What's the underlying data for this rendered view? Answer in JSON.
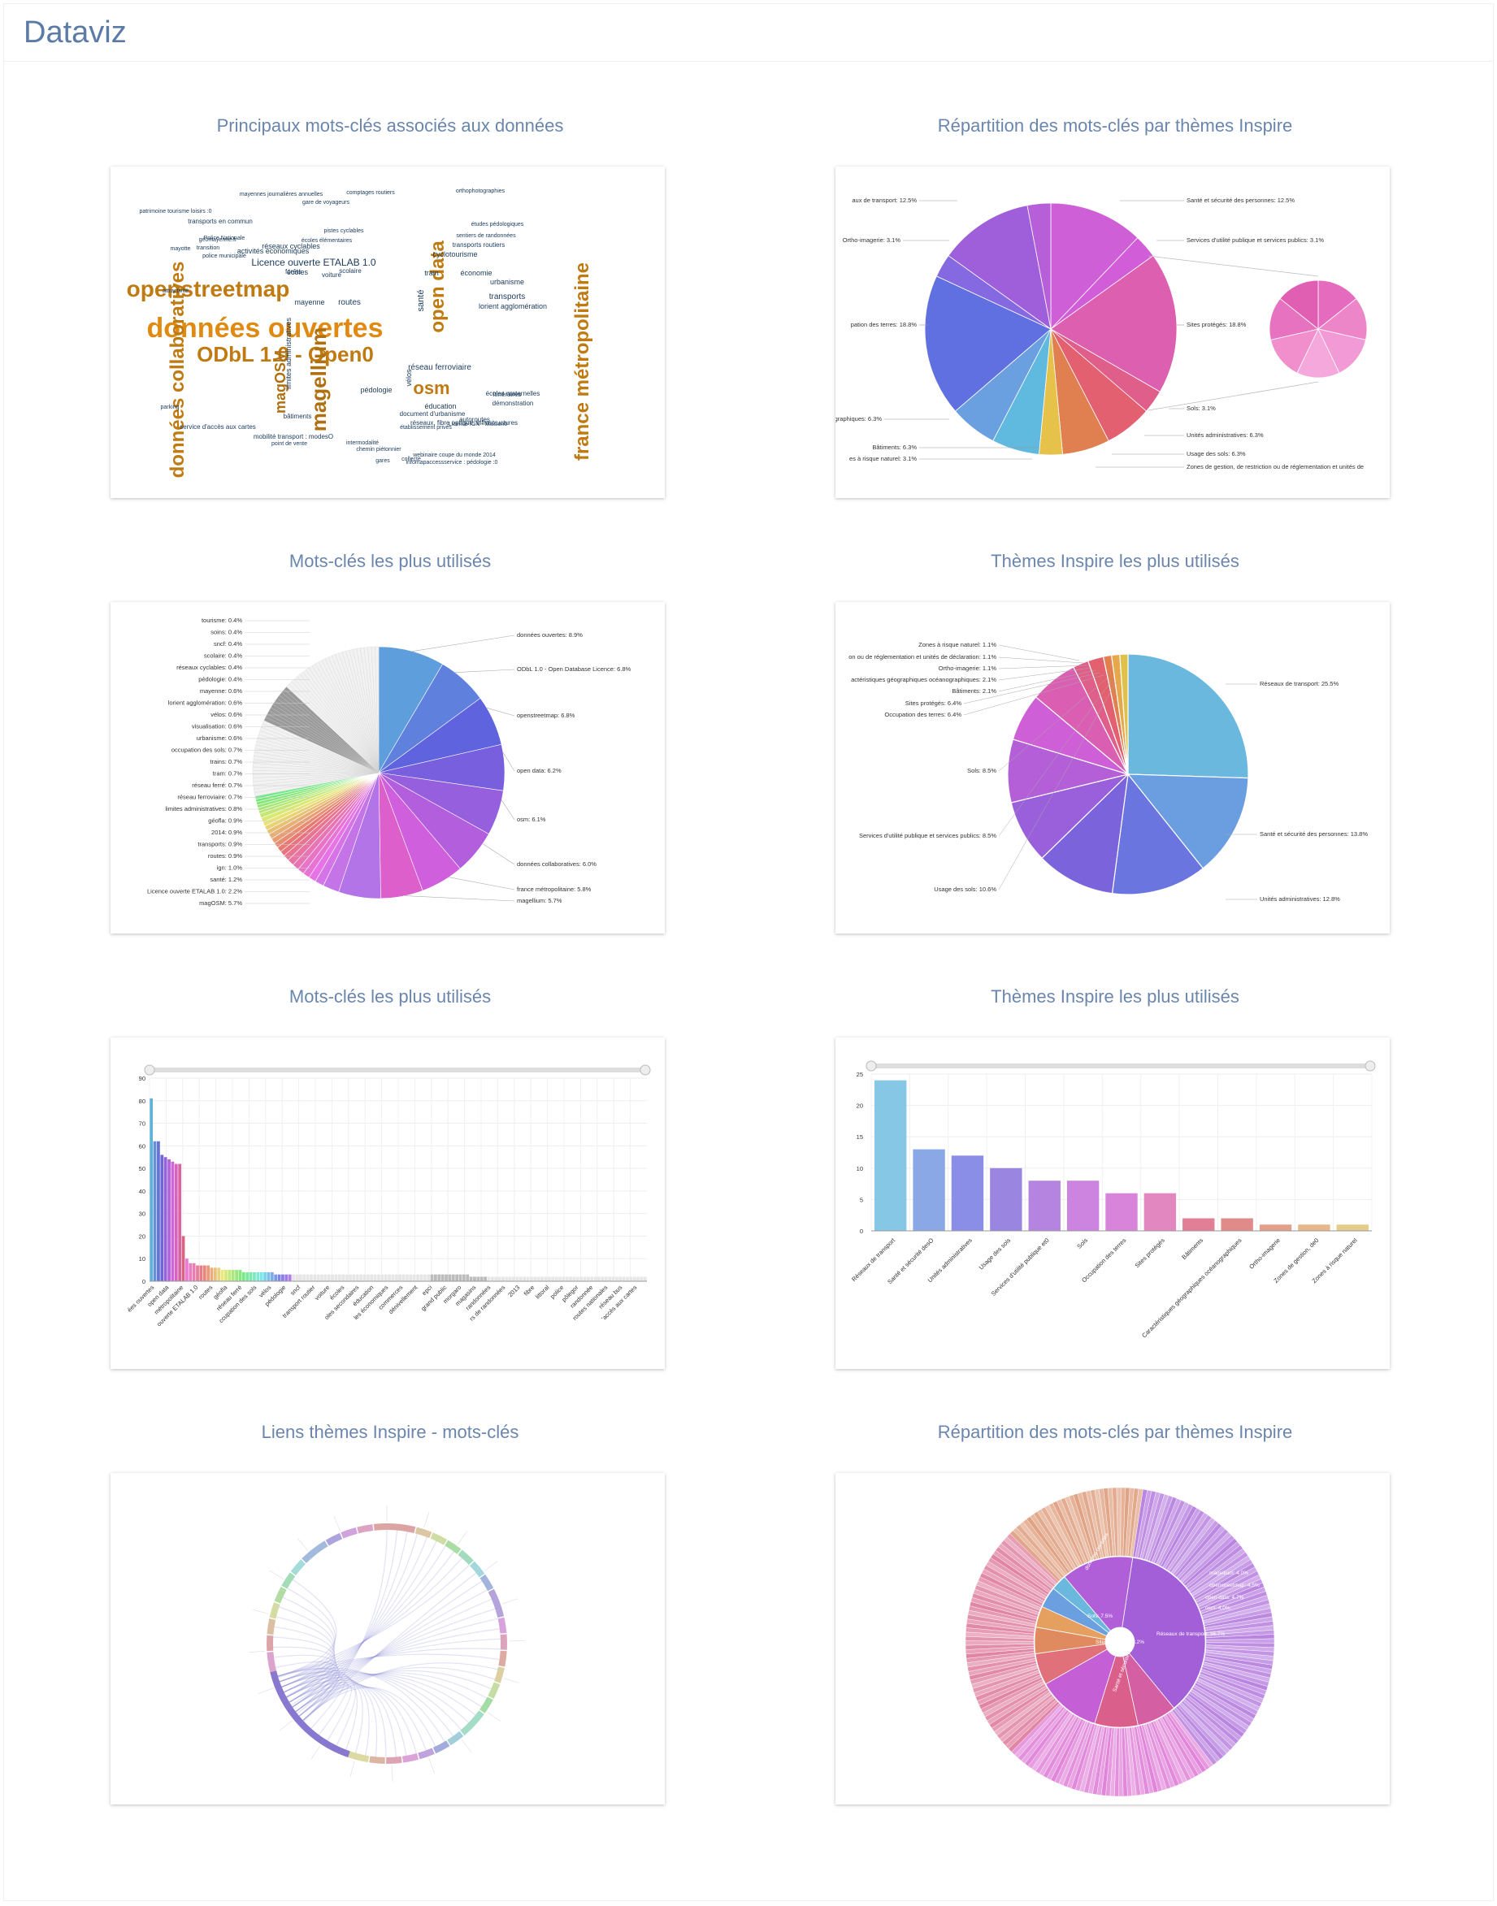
{
  "app": {
    "title": "Dataviz"
  },
  "panels": [
    {
      "title": "Principaux mots-clés associés aux données"
    },
    {
      "title": "Répartition des mots-clés par thèmes Inspire"
    },
    {
      "title": "Mots-clés les plus utilisés"
    },
    {
      "title": "Thèmes Inspire les plus utilisés"
    },
    {
      "title": "Mots-clés les plus utilisés"
    },
    {
      "title": "Thèmes Inspire les plus utilisés"
    },
    {
      "title": "Liens thèmes Inspire - mots-clés"
    },
    {
      "title": "Répartition des mots-clés par thèmes Inspire"
    }
  ],
  "wordcloud": {
    "words": [
      {
        "text": "données ouvertes",
        "color": "#e08a12"
      },
      {
        "text": "openstreetmap",
        "color": "#c07a12"
      },
      {
        "text": "ODbL 1.0 - Open0",
        "color": "#c07a12"
      },
      {
        "text": "données collaboratives",
        "color": "#c07a12"
      },
      {
        "text": "magellium",
        "color": "#b07012"
      },
      {
        "text": "france métropolitaine",
        "color": "#c07a12"
      },
      {
        "text": "open data",
        "color": "#c07a12"
      },
      {
        "text": "magOSM",
        "color": "#b07012"
      },
      {
        "text": "osm",
        "color": "#c07a12"
      },
      {
        "text": "Licence ouverte ETALAB 1.0",
        "color": "#1a3a5c"
      },
      {
        "text": "routes",
        "color": "#1a3a5c"
      },
      {
        "text": "santé",
        "color": "#1a3a5c"
      },
      {
        "text": "mayenne",
        "color": "#1a3a5c"
      },
      {
        "text": "transports",
        "color": "#1a3a5c"
      },
      {
        "text": "réseau ferroviaire",
        "color": "#1a3a5c"
      },
      {
        "text": "éducation",
        "color": "#1a3a5c"
      },
      {
        "text": "urbanisme",
        "color": "#1a3a5c"
      },
      {
        "text": "pédologie",
        "color": "#1a3a5c"
      },
      {
        "text": "vélos",
        "color": "#1a3a5c"
      },
      {
        "text": "écoles",
        "color": "#1a3a5c"
      },
      {
        "text": "scolaire",
        "color": "#1a3a5c"
      },
      {
        "text": "cyclotourisme",
        "color": "#1a3a5c"
      },
      {
        "text": "réseaux cyclables",
        "color": "#1a3a5c"
      },
      {
        "text": "activités économiques",
        "color": "#1a3a5c"
      },
      {
        "text": "transports en commun",
        "color": "#1a3a5c"
      },
      {
        "text": "lorient agglomération",
        "color": "#1a3a5c"
      },
      {
        "text": "démonstration",
        "color": "#1a3a5c"
      },
      {
        "text": "bâtiments",
        "color": "#1a3a5c"
      },
      {
        "text": "écoles maternelles",
        "color": "#1a3a5c"
      },
      {
        "text": "itinéraires",
        "color": "#1a3a5c"
      },
      {
        "text": "autoroutes",
        "color": "#1a3a5c"
      },
      {
        "text": "service d'accès aux cartes",
        "color": "#1a3a5c"
      },
      {
        "text": "mobilité transport : modesO",
        "color": "#1a3a5c"
      },
      {
        "text": "point de vente",
        "color": "#1a3a5c"
      },
      {
        "text": "intermodalité",
        "color": "#1a3a5c"
      },
      {
        "text": "document d'urbanisme",
        "color": "#1a3a5c"
      },
      {
        "text": "infomapaccessservice : pédologie :0",
        "color": "#1a3a5c"
      },
      {
        "text": "mayennes journalières annuelles",
        "color": "#1a3a5c"
      },
      {
        "text": "comptages routiers",
        "color": "#1a3a5c"
      },
      {
        "text": "orthophotographies",
        "color": "#1a3a5c"
      },
      {
        "text": "patrimoine tourisme loisirs :0",
        "color": "#1a3a5c"
      },
      {
        "text": "écoles élémentaires",
        "color": "#1a3a5c"
      },
      {
        "text": "pistes cyclables",
        "color": "#1a3a5c"
      },
      {
        "text": "transports routiers",
        "color": "#1a3a5c"
      },
      {
        "text": "gare de voyageurs",
        "color": "#1a3a5c"
      },
      {
        "text": "sentiers de randonnées",
        "color": "#1a3a5c"
      },
      {
        "text": "études pédologiques",
        "color": "#1a3a5c"
      },
      {
        "text": "établissement privés",
        "color": "#1a3a5c"
      },
      {
        "text": "Licence IGN - Mission0",
        "color": "#1a3a5c"
      },
      {
        "text": "chemin piétonnier",
        "color": "#1a3a5c"
      },
      {
        "text": "webinaire coupe du monde 2014",
        "color": "#1a3a5c"
      },
      {
        "text": "réseaux, fibre optique, infrastructures",
        "color": "#1a3a5c"
      },
      {
        "text": "limites administratives",
        "color": "#1a3a5c"
      },
      {
        "text": "Police Nationale",
        "color": "#1a3a5c"
      },
      {
        "text": "police municipale",
        "color": "#1a3a5c"
      },
      {
        "text": "transition",
        "color": "#1a3a5c"
      },
      {
        "text": "géomayenne.fr",
        "color": "#1a3a5c"
      },
      {
        "text": "voiture",
        "color": "#1a3a5c"
      },
      {
        "text": "forêts",
        "color": "#1a3a5c"
      },
      {
        "text": "train",
        "color": "#1a3a5c"
      },
      {
        "text": "économie",
        "color": "#1a3a5c"
      },
      {
        "text": "gares",
        "color": "#1a3a5c"
      },
      {
        "text": "collecte",
        "color": "#1a3a5c"
      },
      {
        "text": "attractivité",
        "color": "#1a3a5c"
      },
      {
        "text": "mayotte",
        "color": "#1a3a5c"
      },
      {
        "text": "parking",
        "color": "#1a3a5c"
      }
    ]
  },
  "pie_top_right": {
    "labels": [
      "Santé et sécurité des personnes: 12.5%",
      "Services d'utilité publique et services publics: 3.1%",
      "Sites protégés: 18.8%",
      "Sols: 3.1%",
      "Unités administratives: 6.3%",
      "Usage des sols: 6.3%",
      "Zones de gestion, de restriction ou de réglementation et unités de",
      "aux de transport: 12.5%",
      "Ortho-imagerie: 3.1%",
      "pation des terres: 18.8%",
      "céanographiques: 6.3%",
      "Bâtiments: 6.3%",
      "es à risque naturel: 3.1%"
    ]
  },
  "pie_keywords": {
    "right_labels": [
      "données ouvertes: 8.9%",
      "ODbL 1.0 - Open Database Licence: 6.8%",
      "openstreetmap: 6.8%",
      "open data: 6.2%",
      "osm: 6.1%",
      "données collaboratives: 6.0%",
      "france métropolitaine: 5.8%",
      "magellium: 5.7%"
    ],
    "left_labels": [
      "tourisme: 0.4%",
      "soins: 0.4%",
      "sncf: 0.4%",
      "scolaire: 0.4%",
      "réseaux cyclables: 0.4%",
      "pédologie: 0.4%",
      "mayenne: 0.6%",
      "lorient agglomération: 0.6%",
      "vélos: 0.6%",
      "visualisation: 0.6%",
      "urbanisme: 0.6%",
      "occupation des sols: 0.7%",
      "trains: 0.7%",
      "tram: 0.7%",
      "réseau ferré: 0.7%",
      "réseau ferroviaire: 0.7%",
      "limites administratives: 0.8%",
      "géofla: 0.9%",
      "2014: 0.9%",
      "transports: 0.9%",
      "routes: 0.9%",
      "ign: 1.0%",
      "santé: 1.2%",
      "Licence ouverte ETALAB 1.0: 2.2%",
      "magOSM: 5.7%"
    ]
  },
  "pie_themes": {
    "labels": [
      "Zones à risque naturel: 1.1%",
      "on ou de réglementation et unités de déclaration: 1.1%",
      "Ortho-imagerie: 1.1%",
      "actéristiques géographiques océanographiques: 2.1%",
      "Bâtiments: 2.1%",
      "Sites protégés: 6.4%",
      "Occupation des terres: 6.4%",
      "Sols: 8.5%",
      "Services d'utilité publique et services publics: 8.5%",
      "Usage des sols: 10.6%",
      "Réseaux de transport: 25.5%",
      "Santé et sécurité des personnes: 13.8%",
      "Unités administratives: 12.8%"
    ]
  },
  "bar_keywords": {
    "yticks": [
      "0",
      "10",
      "20",
      "30",
      "40",
      "50",
      "60",
      "70",
      "80",
      "90"
    ],
    "xlabels": [
      "ées ouvertes",
      "open data",
      "métropolitaine",
      "ouverte ETALAB 1.0",
      "routes",
      "géofla",
      "réseau ferré",
      "ccupation des sols",
      "vélos",
      "pédologie",
      "sncf",
      "transport routier",
      "voiture",
      "écoles",
      "oles secondaires",
      "éducation",
      "les économiques",
      "commerces",
      "dénivellement",
      "epci",
      "grand public",
      "morgaro",
      "magasins",
      "randonnées",
      "rs de randonnées",
      "2013",
      "fibre",
      "littoral",
      "police",
      "pôlegor",
      "randonnée",
      "routes nationales",
      "réseau bus",
      "'accès aux cartes"
    ]
  },
  "bar_themes": {
    "yticks": [
      "0",
      "5",
      "10",
      "15",
      "20",
      "25"
    ],
    "xlabels": [
      "Réseaux de transport",
      "Santé et sécurité desO",
      "Unités administratives",
      "Usage des sols",
      "Services d'utilité publique et0",
      "Sols",
      "Occupation des terres",
      "Sites protégés",
      "Bâtiments",
      "Caractéristiques géographiques océanographiques",
      "Ortho-imagerie",
      "Zones de gestion, de0",
      "Zones à risque naturel"
    ]
  },
  "sunburst": {
    "labels": [
      "Réseaux de transport: 36.7%",
      "Sols: 7.5%",
      "Sites protégés: 8.2%",
      "Santé et sécurité",
      "données ouvertes",
      "open data: 4.7%",
      "magellium: 4.0%",
      "openstreetmap: 4.5%",
      "osm: 4.0%"
    ]
  },
  "chart_data": [
    {
      "type": "pie",
      "title": "Répartition des mots-clés par thèmes Inspire",
      "categories": [
        "Santé et sécurité des personnes",
        "Services d'utilité publique et services publics",
        "Sites protégés",
        "Sols",
        "Unités administratives",
        "Usage des sols",
        "Zones de gestion, de restriction ou de réglementation et unités de",
        "Bâtiments",
        "céanographiques",
        "pation des terres",
        "Ortho-imagerie",
        "aux de transport",
        "es à risque naturel"
      ],
      "values": [
        12.5,
        3.1,
        18.8,
        3.1,
        6.3,
        6.3,
        3.1,
        6.3,
        6.3,
        18.8,
        3.1,
        12.5,
        3.1
      ]
    },
    {
      "type": "pie",
      "title": "Mots-clés les plus utilisés",
      "categories": [
        "données ouvertes",
        "ODbL 1.0 - Open Database Licence",
        "openstreetmap",
        "open data",
        "osm",
        "données collaboratives",
        "france métropolitaine",
        "magellium",
        "magOSM",
        "Licence ouverte ETALAB 1.0",
        "santé",
        "ign",
        "routes",
        "transports",
        "2014",
        "géofla",
        "limites administratives",
        "réseau ferroviaire",
        "réseau ferré",
        "tram",
        "trains",
        "occupation des sols",
        "urbanisme",
        "visualisation",
        "vélos",
        "lorient agglomération",
        "mayenne",
        "pédologie",
        "réseaux cyclables",
        "scolaire",
        "sncf",
        "soins",
        "tourisme"
      ],
      "values": [
        8.9,
        6.8,
        6.8,
        6.2,
        6.1,
        6.0,
        5.8,
        5.7,
        5.7,
        2.2,
        1.2,
        1.0,
        0.9,
        0.9,
        0.9,
        0.9,
        0.8,
        0.7,
        0.7,
        0.7,
        0.7,
        0.7,
        0.6,
        0.6,
        0.6,
        0.6,
        0.6,
        0.4,
        0.4,
        0.4,
        0.4,
        0.4,
        0.4
      ]
    },
    {
      "type": "pie",
      "title": "Thèmes Inspire les plus utilisés",
      "categories": [
        "Réseaux de transport",
        "Santé et sécurité des personnes",
        "Unités administratives",
        "Usage des sols",
        "Services d'utilité publique et services publics",
        "Sols",
        "Occupation des terres",
        "Sites protégés",
        "Bâtiments",
        "actéristiques géographiques océanographiques",
        "Ortho-imagerie",
        "on ou de réglementation et unités de déclaration",
        "Zones à risque naturel"
      ],
      "values": [
        25.5,
        13.8,
        12.8,
        10.6,
        8.5,
        8.5,
        6.4,
        6.4,
        2.1,
        2.1,
        1.1,
        1.1,
        1.1
      ]
    },
    {
      "type": "bar",
      "title": "Mots-clés les plus utilisés",
      "ylim": [
        0,
        90
      ],
      "values": [
        81,
        62,
        62,
        56,
        55,
        54,
        53,
        52,
        52,
        20,
        10,
        8,
        8,
        7,
        7,
        7,
        7,
        6,
        6,
        6,
        5,
        5,
        5,
        5,
        5,
        5,
        4,
        4,
        4,
        4,
        4,
        4,
        4,
        4,
        4,
        3,
        3,
        3,
        3,
        3,
        3,
        3,
        3,
        3,
        3,
        3,
        3,
        3,
        3,
        3,
        3,
        3,
        3,
        3,
        3,
        3,
        3,
        3,
        3,
        3,
        3,
        3,
        3,
        3,
        3,
        3,
        3,
        3,
        3,
        3,
        3,
        3,
        3,
        3,
        3,
        3,
        3,
        3,
        3,
        3,
        3,
        3,
        3,
        3,
        3,
        3,
        3,
        3,
        3,
        3,
        2,
        2,
        2,
        2,
        2,
        2,
        2,
        2,
        2,
        2,
        2,
        2,
        2,
        2,
        2,
        2,
        2,
        2,
        2,
        2,
        2,
        2,
        2,
        2,
        2,
        2,
        2,
        2,
        2,
        2,
        2,
        2,
        2,
        2,
        2,
        2,
        2,
        2,
        2,
        2,
        2,
        2,
        2,
        2,
        2,
        2,
        2,
        2,
        2,
        2
      ]
    },
    {
      "type": "bar",
      "title": "Thèmes Inspire les plus utilisés",
      "categories": [
        "Réseaux de transport",
        "Santé et sécurité desO",
        "Unités administratives",
        "Usage des sols",
        "Services d'utilité publique et0",
        "Sols",
        "Occupation des terres",
        "Sites protégés",
        "Bâtiments",
        "Caractéristiques géographiques océanographiques",
        "Ortho-imagerie",
        "Zones de gestion, de0",
        "Zones à risque naturel"
      ],
      "values": [
        24,
        13,
        12,
        10,
        8,
        8,
        6,
        6,
        2,
        2,
        1,
        1,
        1
      ],
      "ylim": [
        0,
        25
      ]
    }
  ]
}
